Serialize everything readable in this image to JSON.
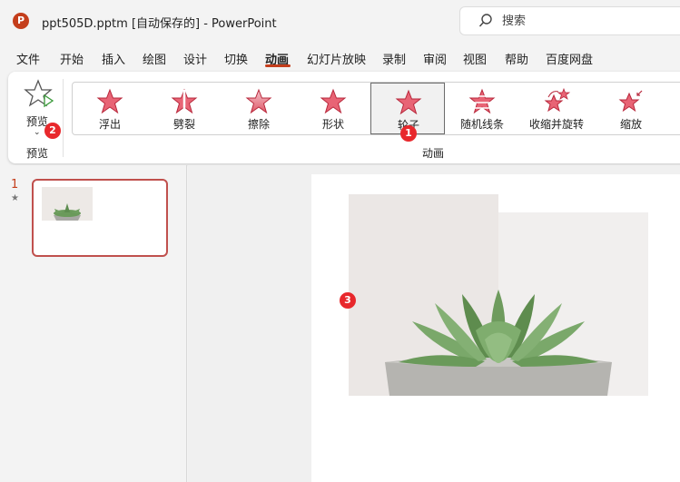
{
  "titlebar": {
    "logo": "P",
    "title": "ppt505D.pptm [自动保存的]  -  PowerPoint",
    "search_placeholder": "搜索",
    "search_icon": "search-icon"
  },
  "menu": {
    "items": [
      "文件",
      "开始",
      "插入",
      "绘图",
      "设计",
      "切换",
      "动画",
      "幻灯片放映",
      "录制",
      "审阅",
      "视图",
      "帮助",
      "百度网盘"
    ],
    "active": "动画"
  },
  "ribbon": {
    "preview_label": "预览",
    "preview_group_label": "预览",
    "animation_group_label": "动画",
    "animations": [
      {
        "label": "浮出",
        "icon": "float-in-star-icon",
        "selected": false
      },
      {
        "label": "劈裂",
        "icon": "split-star-icon",
        "selected": false
      },
      {
        "label": "擦除",
        "icon": "wipe-star-icon",
        "selected": false
      },
      {
        "label": "形状",
        "icon": "shape-star-icon",
        "selected": false
      },
      {
        "label": "轮子",
        "icon": "wheel-star-icon",
        "selected": true
      },
      {
        "label": "随机线条",
        "icon": "random-bars-star-icon",
        "selected": false
      },
      {
        "label": "收缩并旋转",
        "icon": "shrink-turn-star-icon",
        "selected": false
      },
      {
        "label": "缩放",
        "icon": "zoom-star-icon",
        "selected": false
      }
    ]
  },
  "badges": {
    "b1": "1",
    "b2": "2",
    "b3": "3"
  },
  "thumbnails": {
    "slide_number": "1",
    "animation_marker": "★"
  },
  "colors": {
    "accent": "#c43e1c",
    "badge": "#e8282c",
    "star": "#e05a6a"
  }
}
